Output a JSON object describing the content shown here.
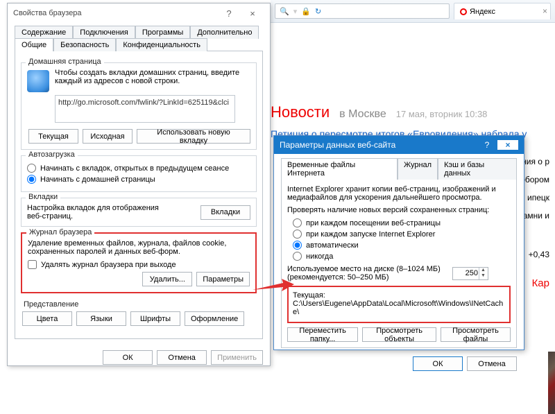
{
  "browserBg": {
    "searchPlaceholder": "",
    "tabTitle": "Яндекс",
    "news": {
      "title": "Новости",
      "city": "в Москве",
      "date": "17 мая, вторник 10:38",
      "items": [
        "Петиция о пересмотре итогов «Евровидения» набрала у",
        "ения о р",
        "обором",
        "ипецк",
        "амни и"
      ]
    },
    "sideTicker": "+0,43",
    "sideMap": "Кар"
  },
  "dlg": {
    "title": "Свойства браузера",
    "helpBtn": "?",
    "closeBtn": "×",
    "tabsTop": [
      "Содержание",
      "Подключения",
      "Программы",
      "Дополнительно"
    ],
    "tabsBottom": [
      "Общие",
      "Безопасность",
      "Конфиденциальность"
    ],
    "homepage": {
      "legend": "Домашняя страница",
      "text": "Чтобы создать вкладки домашних страниц, введите каждый из адресов с новой строки.",
      "url": "http://go.microsoft.com/fwlink/?LinkId=625119&clci",
      "btnCurrent": "Текущая",
      "btnDefault": "Исходная",
      "btnNewTab": "Использовать новую вкладку"
    },
    "autostart": {
      "legend": "Автозагрузка",
      "opt1": "Начинать с вкладок, открытых в предыдущем сеансе",
      "opt2": "Начинать с домашней страницы"
    },
    "tabsSection": {
      "legend": "Вкладки",
      "text": "Настройка вкладок для отображения веб-страниц.",
      "btn": "Вкладки"
    },
    "history": {
      "legend": "Журнал браузера",
      "text": "Удаление временных файлов, журнала, файлов cookie, сохраненных паролей и данных веб-форм.",
      "check": "Удалять журнал браузера при выходе",
      "btnDelete": "Удалить...",
      "btnSettings": "Параметры"
    },
    "appearance": {
      "legend": "Представление",
      "btns": [
        "Цвета",
        "Языки",
        "Шрифты",
        "Оформление"
      ]
    },
    "footer": {
      "ok": "ОК",
      "cancel": "Отмена",
      "apply": "Применить"
    }
  },
  "dlg2": {
    "title": "Параметры данных веб-сайта",
    "help": "?",
    "close": "×",
    "tabs": [
      "Временные файлы Интернета",
      "Журнал",
      "Кэш и базы данных"
    ],
    "info": "Internet Explorer хранит копии веб-страниц, изображений и медиафайлов для ускорения дальнейшего просмотра.",
    "checkLabel": "Проверять наличие новых версий сохраненных страниц:",
    "radios": [
      "при каждом посещении веб-страницы",
      "при каждом запуске Internet Explorer",
      "автоматически",
      "никогда"
    ],
    "radioSelected": 2,
    "diskLabel": "Используемое место на диске (8–1024 МБ) (рекомендуется: 50–250 МБ)",
    "diskValue": "250",
    "currentLabel": "Текущая:",
    "currentPath": "C:\\Users\\Eugene\\AppData\\Local\\Microsoft\\Windows\\INetCache\\",
    "btns": {
      "move": "Переместить папку...",
      "viewObj": "Просмотреть объекты",
      "viewFiles": "Просмотреть файлы"
    },
    "ok": "ОК",
    "cancel": "Отмена"
  }
}
